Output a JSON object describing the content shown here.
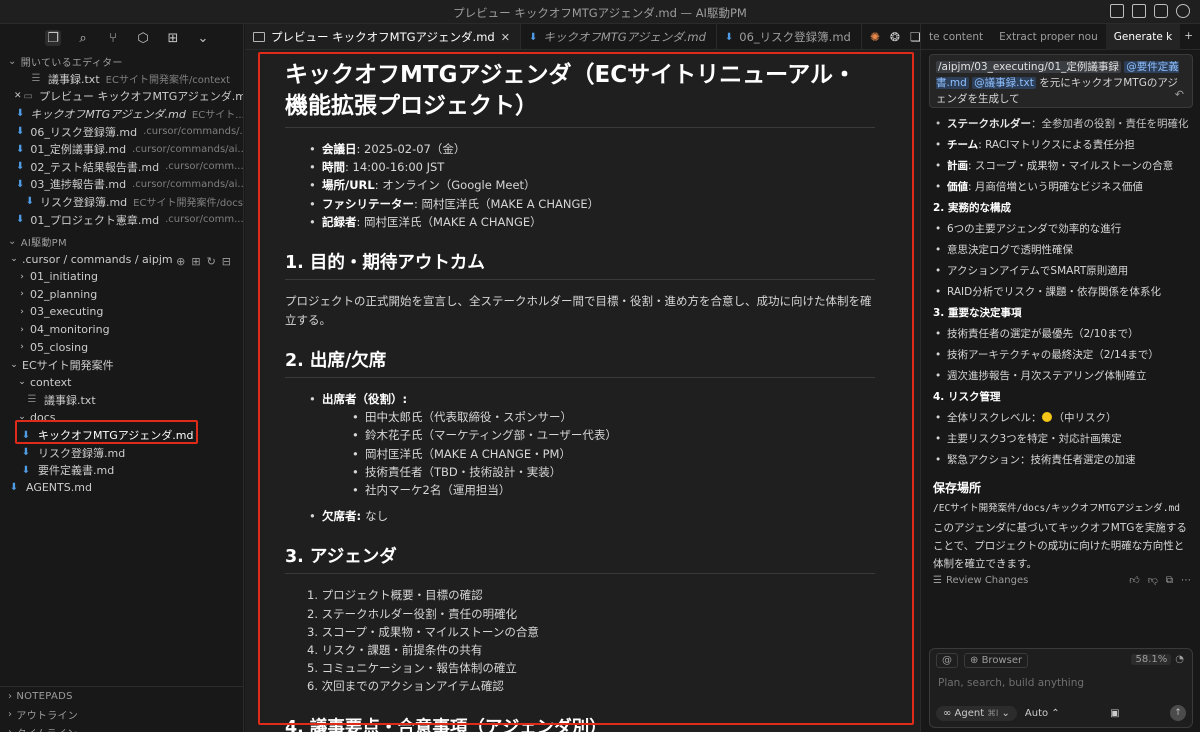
{
  "window": {
    "title": "プレビュー キックオフMTGアジェンダ.md — AI駆動PM"
  },
  "sidebar": {
    "open_editors_label": "開いているエディター",
    "open_editors": [
      {
        "name": "議事録.txt",
        "path": "ECサイト開発案件/context",
        "type": "txt",
        "close": ""
      },
      {
        "name": "プレビュー キックオフMTGアジェンダ.md",
        "path": "",
        "type": "preview",
        "close": "✕"
      },
      {
        "name": "キックオフMTGアジェンダ.md",
        "path": "ECサイト...",
        "type": "md",
        "close": ""
      },
      {
        "name": "06_リスク登録簿.md",
        "path": ".cursor/commands/...",
        "type": "md",
        "close": ""
      },
      {
        "name": "01_定例議事録.md",
        "path": ".cursor/commands/ai...",
        "type": "md",
        "close": ""
      },
      {
        "name": "02_テスト結果報告書.md",
        "path": ".cursor/comm...",
        "type": "md",
        "close": ""
      },
      {
        "name": "03_進捗報告書.md",
        "path": ".cursor/commands/ai...",
        "type": "md",
        "close": ""
      },
      {
        "name": "リスク登録簿.md",
        "path": "ECサイト開発案件/docs",
        "type": "md",
        "close": ""
      },
      {
        "name": "01_プロジェクト憲章.md",
        "path": ".cursor/comm...",
        "type": "md",
        "close": ""
      }
    ],
    "workspace_label": "AI駆動PM",
    "tree": [
      {
        "label": ".cursor / commands / aipjm",
        "chev": "⌄",
        "kind": "folder"
      },
      {
        "label": "01_initiating",
        "chev": "›",
        "kind": "folder"
      },
      {
        "label": "02_planning",
        "chev": "›",
        "kind": "folder"
      },
      {
        "label": "03_executing",
        "chev": "›",
        "kind": "folder"
      },
      {
        "label": "04_monitoring",
        "chev": "›",
        "kind": "folder"
      },
      {
        "label": "05_closing",
        "chev": "›",
        "kind": "folder"
      },
      {
        "label": "ECサイト開発案件",
        "chev": "⌄",
        "kind": "folder"
      },
      {
        "label": "context",
        "chev": "⌄",
        "kind": "folder"
      },
      {
        "label": "議事録.txt",
        "chev": "",
        "kind": "txt"
      },
      {
        "label": "docs",
        "chev": "⌄",
        "kind": "folder"
      },
      {
        "label": "キックオフMTGアジェンダ.md",
        "chev": "",
        "kind": "md"
      },
      {
        "label": "リスク登録簿.md",
        "chev": "",
        "kind": "md"
      },
      {
        "label": "要件定義書.md",
        "chev": "",
        "kind": "md"
      },
      {
        "label": "AGENTS.md",
        "chev": "",
        "kind": "md"
      }
    ],
    "bottom_sections": [
      "NOTEPADS",
      "アウトライン",
      "タイムライン"
    ]
  },
  "editor": {
    "tabs": [
      {
        "label": "プレビュー キックオフMTGアジェンダ.md",
        "active": true
      },
      {
        "label": "キックオフMTGアジェンダ.md",
        "active": false
      },
      {
        "label": "06_リスク登録簿.md",
        "active": false
      }
    ],
    "doc": {
      "title": "キックオフMTGアジェンダ（ECサイトリニューアル・機能拡張プロジェクト）",
      "meta": [
        {
          "k": "会議日",
          "v": "2025-02-07（金）"
        },
        {
          "k": "時間",
          "v": "14:00-16:00 JST"
        },
        {
          "k": "場所/URL",
          "v": "オンライン（Google Meet）"
        },
        {
          "k": "ファシリテーター",
          "v": "岡村匡洋氏（MAKE A CHANGE）"
        },
        {
          "k": "記録者",
          "v": "岡村匡洋氏（MAKE A CHANGE）"
        }
      ],
      "s1_title": "1. 目的・期待アウトカム",
      "s1_text": "プロジェクトの正式開始を宣言し、全ステークホルダー間で目標・役割・進め方を合意し、成功に向けた体制を確立する。",
      "s2_title": "2. 出席/欠席",
      "attendees_label": "出席者（役割）",
      "attendees": [
        "田中太郎氏（代表取締役・スポンサー）",
        "鈴木花子氏（マーケティング部・ユーザー代表）",
        "岡村匡洋氏（MAKE A CHANGE・PM）",
        "技術責任者（TBD・技術設計・実装）",
        "社内マーケ2名（運用担当）"
      ],
      "absent_label": "欠席者",
      "absent_value": "なし",
      "s3_title": "3. アジェンダ",
      "agenda": [
        "1. プロジェクト概要・目標の確認",
        "2. ステークホルダー役割・責任の明確化",
        "3. スコープ・成果物・マイルストーンの合意",
        "4. リスク・課題・前提条件の共有",
        "5. コミュニケーション・報告体制の確立",
        "6. 次回までのアクションアイテム確認"
      ],
      "s4_title": "4. 議事要点・合意事項（アジェンダ別）"
    }
  },
  "chat": {
    "tabs": [
      "te content",
      "Extract proper nou",
      "Generate k"
    ],
    "prompt": {
      "chip1": "/aipjm/03_executing/01_定例議事録",
      "chip2": "@要件定義書.md",
      "chip3": "@議事録.txt",
      "text": "を元にキックオフMTGのアジェンダを生成して"
    },
    "lines": [
      {
        "kind": "li",
        "b": "ステークホルダー",
        "t": "：全参加者の役割・責任を明確化"
      },
      {
        "kind": "li",
        "b": "チーム",
        "t": ": RACIマトリクスによる責任分担"
      },
      {
        "kind": "li",
        "b": "計画",
        "t": ": スコープ・成果物・マイルストーンの合意"
      },
      {
        "kind": "li",
        "b": "価値",
        "t": ": 月商倍増という明確なビジネス価値"
      },
      {
        "kind": "h",
        "b": "2. 実務的な構成",
        "t": ""
      },
      {
        "kind": "li",
        "b": "",
        "t": "6つの主要アジェンダで効率的な進行"
      },
      {
        "kind": "li",
        "b": "",
        "t": "意思決定ログで透明性確保"
      },
      {
        "kind": "li",
        "b": "",
        "t": "アクションアイテムでSMART原則適用"
      },
      {
        "kind": "li",
        "b": "",
        "t": "RAID分析でリスク・課題・依存関係を体系化"
      },
      {
        "kind": "h",
        "b": "3. 重要な決定事項",
        "t": ""
      },
      {
        "kind": "li",
        "b": "",
        "t": "技術責任者の選定が最優先（2/10まで）"
      },
      {
        "kind": "li",
        "b": "",
        "t": "技術アーキテクチャの最終決定（2/14まで）"
      },
      {
        "kind": "li",
        "b": "",
        "t": "週次進捗報告・月次ステアリング体制確立"
      },
      {
        "kind": "h",
        "b": "4. リスク管理",
        "t": ""
      },
      {
        "kind": "risk",
        "b": "",
        "t": "全体リスクレベル：",
        "t2": "（中リスク）"
      },
      {
        "kind": "li",
        "b": "",
        "t": "主要リスク3つを特定・対応計画策定"
      },
      {
        "kind": "li",
        "b": "",
        "t": "緊急アクション：技術責任者選定の加速"
      }
    ],
    "save_heading": "保存場所",
    "save_path": "/ECサイト開発案件/docs/キックオフMTGアジェンダ.md",
    "closing": "このアジェンダに基づいてキックオフMTGを実施することで、プロジェクトの成功に向けた明確な方向性と体制を確立できます。",
    "review_label": "Review Changes",
    "composer": {
      "browser_label": "Browser",
      "percent": "58.1%",
      "placeholder": "Plan, search, build anything",
      "agent_label": "Agent",
      "agent_shortcut": "⌘I",
      "auto_label": "Auto"
    }
  },
  "colors": {
    "highlight": "#e02a1a",
    "accent": "#4f9ce5",
    "risk_dot": "#f5c518"
  }
}
